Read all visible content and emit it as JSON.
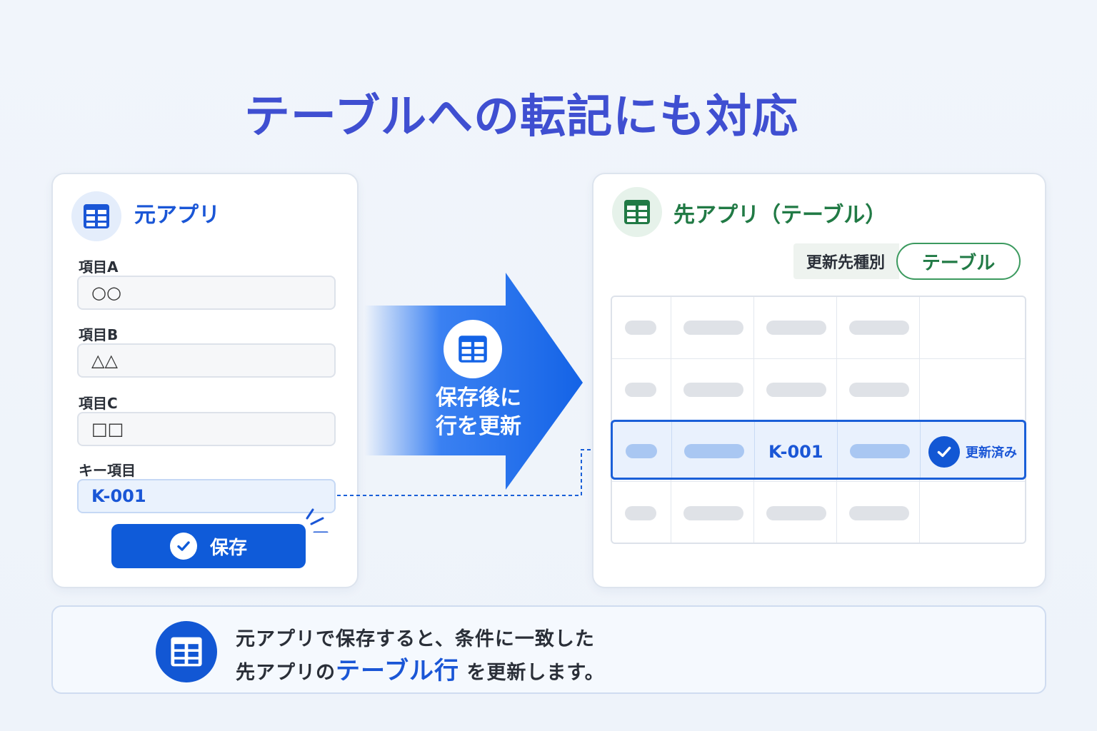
{
  "title": "テーブルへの転記にも対応",
  "source_app": {
    "title": "元アプリ",
    "icon": "table-icon",
    "fields": [
      {
        "label": "項目A",
        "value": "○○"
      },
      {
        "label": "項目B",
        "value": "△△"
      },
      {
        "label": "項目C",
        "value": "□□"
      },
      {
        "label": "キー項目",
        "value": "K-001"
      }
    ],
    "save_label": "保存"
  },
  "arrow": {
    "line1": "保存後に",
    "line2": "行を更新"
  },
  "dest_app": {
    "title": "先アプリ（テーブル）",
    "icon": "table-icon",
    "type_label": "更新先種別",
    "type_value": "テーブル",
    "key_value": "K-001",
    "updated_label": "更新済み"
  },
  "note": {
    "line1": "元アプリで保存すると、条件に一致した",
    "line2_prefix": "先アプリの",
    "line2_emphasis": "テーブル行",
    "line2_suffix": "を更新します。"
  },
  "colors": {
    "accent_blue": "#1257d4",
    "accent_green": "#217a45",
    "title": "#3f4fd1"
  }
}
